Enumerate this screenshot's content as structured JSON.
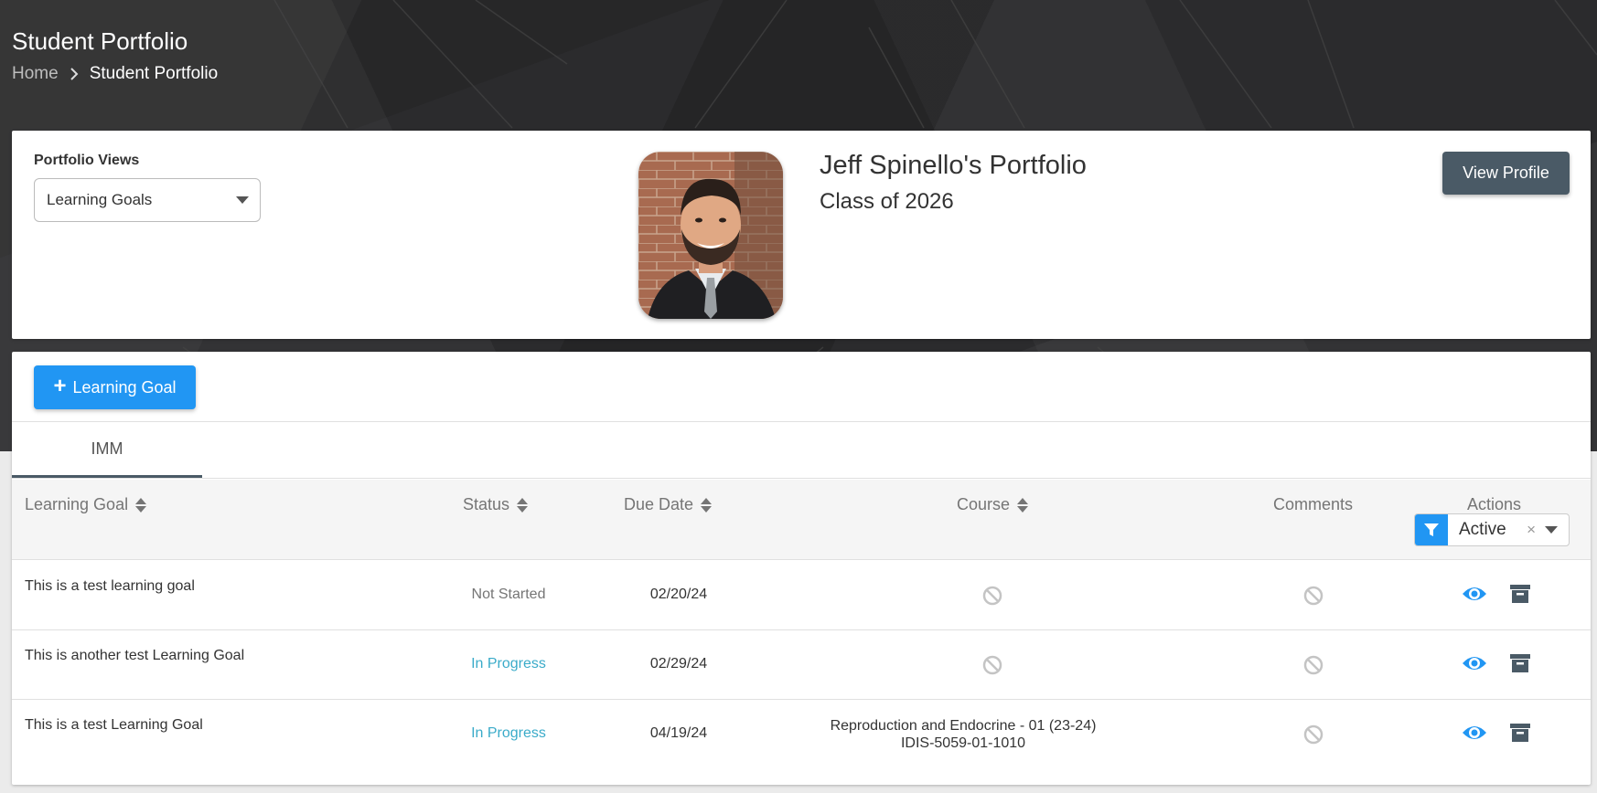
{
  "header": {
    "title": "Student Portfolio",
    "breadcrumb": {
      "home": "Home",
      "current": "Student Portfolio"
    }
  },
  "portfolio": {
    "views_label": "Portfolio Views",
    "views_selected": "Learning Goals",
    "student_name": "Jeff Spinello's Portfolio",
    "class_label": "Class of 2026",
    "view_profile_label": "View Profile"
  },
  "toolbar": {
    "add_goal_label": "Learning Goal"
  },
  "tabs": [
    {
      "label": "IMM",
      "active": true
    }
  ],
  "table": {
    "columns": {
      "goal": "Learning Goal",
      "status": "Status",
      "due": "Due Date",
      "course": "Course",
      "comments": "Comments",
      "actions": "Actions"
    },
    "filter": {
      "value": "Active",
      "clear": "×"
    },
    "rows": [
      {
        "goal": "This is a test learning goal",
        "status": "Not Started",
        "due": "02/20/24",
        "course": "",
        "course_code": ""
      },
      {
        "goal": "This is another test Learning Goal",
        "status": "In Progress",
        "due": "02/29/24",
        "course": "",
        "course_code": ""
      },
      {
        "goal": "This is a test Learning Goal",
        "status": "In Progress",
        "due": "04/19/24",
        "course": "Reproduction and Endocrine - 01 (23-24)",
        "course_code": "IDIS-5059-01-1010"
      }
    ]
  },
  "colors": {
    "primary": "#2196f3",
    "dark_button": "#4a5a66",
    "in_progress": "#3aabc9",
    "muted": "#757575",
    "hero_bg": "#2b2b2d"
  },
  "icons": [
    "chevron-right-icon",
    "caret-down-icon",
    "plus-icon",
    "sort-icon",
    "filter-icon",
    "ban-icon",
    "eye-icon",
    "archive-icon"
  ]
}
